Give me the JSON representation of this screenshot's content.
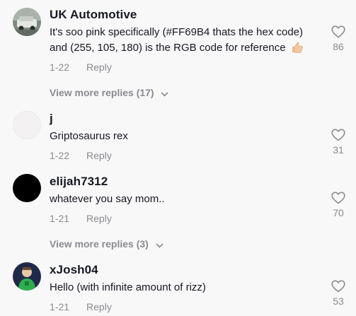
{
  "comments": [
    {
      "username": "UK Automotive",
      "text_part1": "It's soo pink specifically (#FF69B4 thats the hex code)",
      "text_part2": "and (255, 105, 180) is the RGB code for reference",
      "emoji": "thumbs-up-icon",
      "date": "1-22",
      "reply_label": "Reply",
      "likes": "86"
    },
    {
      "username": "j",
      "text": "Griptosaurus rex",
      "date": "1-22",
      "reply_label": "Reply",
      "likes": "31"
    },
    {
      "username": "elijah7312",
      "text": "whatever you say mom..",
      "date": "1-21",
      "reply_label": "Reply",
      "likes": "70"
    },
    {
      "username": "xJosh04",
      "text": "Hello (with infinite amount of rizz)",
      "date": "1-21",
      "reply_label": "Reply",
      "likes": "53"
    }
  ],
  "view_more": [
    {
      "label": "View more replies (17)"
    },
    {
      "label": "View more replies (3)"
    }
  ],
  "colors": {
    "background": "#f8f8f8",
    "text": "#161823",
    "muted": "#8a8b91"
  }
}
